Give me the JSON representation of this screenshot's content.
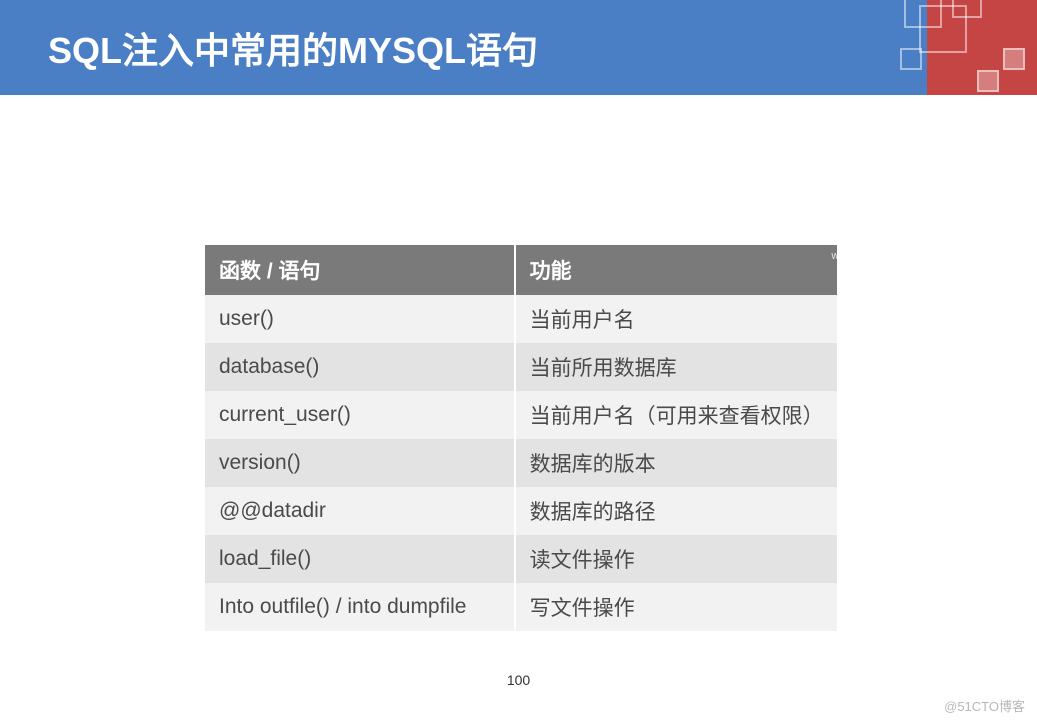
{
  "header": {
    "title": "SQL注入中常用的MYSQL语句"
  },
  "watermark": {
    "right": "www.aqniukt.com"
  },
  "table": {
    "col1": "函数 / 语句",
    "col2": "功能",
    "rows": [
      {
        "func": "user()",
        "desc": "当前用户名"
      },
      {
        "func": "database()",
        "desc": "当前所用数据库"
      },
      {
        "func": "current_user()",
        "desc": "当前用户名（可用来查看权限）"
      },
      {
        "func": "version()",
        "desc": "数据库的版本"
      },
      {
        "func": "@@datadir",
        "desc": "数据库的路径"
      },
      {
        "func": "load_file()",
        "desc": "读文件操作"
      },
      {
        "func": "Into outfile() / into dumpfile",
        "desc": "写文件操作"
      }
    ]
  },
  "page_number": "100",
  "footer": {
    "watermark": "@51CTO博客"
  }
}
